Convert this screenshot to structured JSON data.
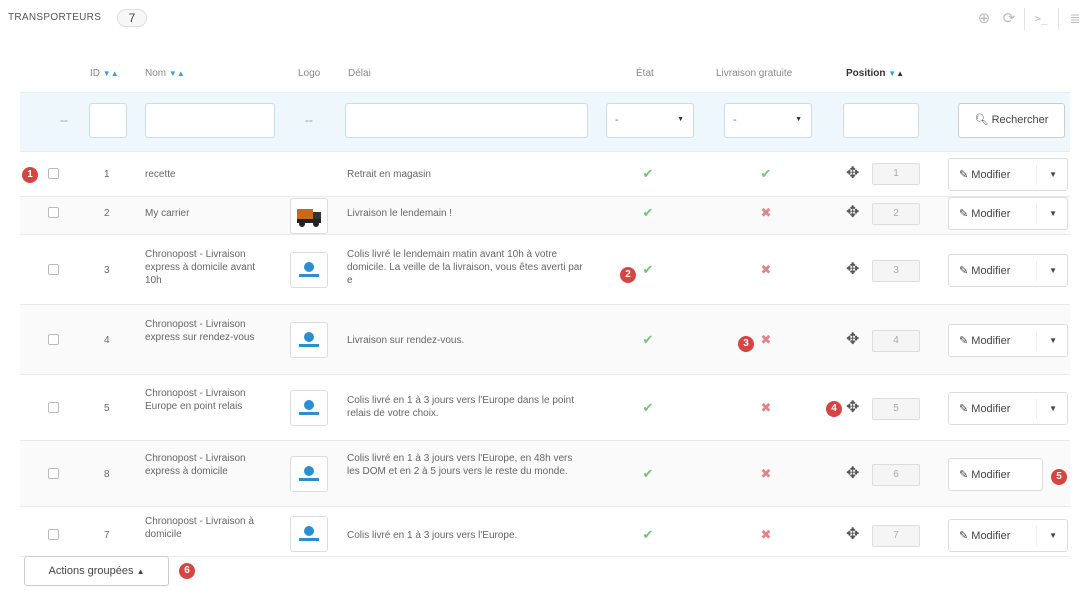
{
  "header": {
    "title": "TRANSPORTEURS",
    "count": "7"
  },
  "toolbar": {
    "icons": [
      "plus-circle-icon",
      "refresh-icon",
      "terminal-icon",
      "database-icon"
    ]
  },
  "columns": {
    "id": "ID",
    "name": "Nom",
    "logo": "Logo",
    "delay": "Délai",
    "status": "État",
    "free_shipping": "Livraison gratuite",
    "position": "Position"
  },
  "filters": {
    "dash_left": "--",
    "dash_logo": "--",
    "status_select": "-",
    "free_select": "-",
    "search_label": "Rechercher"
  },
  "rows": [
    {
      "id": "1",
      "name": "recette",
      "logo": "none",
      "delay": "Retrait en magasin",
      "active": true,
      "free": true,
      "position": "1",
      "action": "Modifier"
    },
    {
      "id": "2",
      "name": "My carrier",
      "logo": "truck",
      "delay": "Livraison le lendemain !",
      "active": true,
      "free": false,
      "position": "2",
      "action": "Modifier"
    },
    {
      "id": "3",
      "name": "Chronopost - Livraison express à domicile avant 10h",
      "logo": "chronopost",
      "delay": "Colis livré le lendemain matin avant 10h à votre domicile. La veille de la livraison, vous êtes averti par e",
      "active": true,
      "free": false,
      "position": "3",
      "action": "Modifier"
    },
    {
      "id": "4",
      "name": "Chronopost - Livraison express sur rendez-vous",
      "logo": "chronopost",
      "delay": "Livraison sur rendez-vous.",
      "active": true,
      "free": false,
      "position": "4",
      "action": "Modifier"
    },
    {
      "id": "5",
      "name": "Chronopost - Livraison Europe en point relais",
      "logo": "chronopost",
      "delay": "Colis livré en 1 à 3 jours vers l'Europe dans le point relais de votre choix.",
      "active": true,
      "free": false,
      "position": "5",
      "action": "Modifier"
    },
    {
      "id": "8",
      "name": "Chronopost - Livraison express à domicile",
      "logo": "chronopost",
      "delay": "Colis livré en 1 à 3 jours vers l'Europe, en 48h vers les DOM et en 2 à 5 jours vers le reste du monde.",
      "active": true,
      "free": false,
      "position": "6",
      "action": "Modifier"
    },
    {
      "id": "7",
      "name": "Chronopost - Livraison à domicile",
      "logo": "chronopost",
      "delay": "Colis livré en 1 à 3 jours vers l'Europe.",
      "active": true,
      "free": false,
      "position": "7",
      "action": "Modifier"
    }
  ],
  "bulk_actions": {
    "label": "Actions groupées"
  },
  "markers": [
    "1",
    "2",
    "3",
    "4",
    "5",
    "6"
  ],
  "colors": {
    "accent": "#3aa0d6",
    "check": "#72c279",
    "cross": "#e08585",
    "marker": "#d64541",
    "filter_bg": "#edf7fc"
  }
}
